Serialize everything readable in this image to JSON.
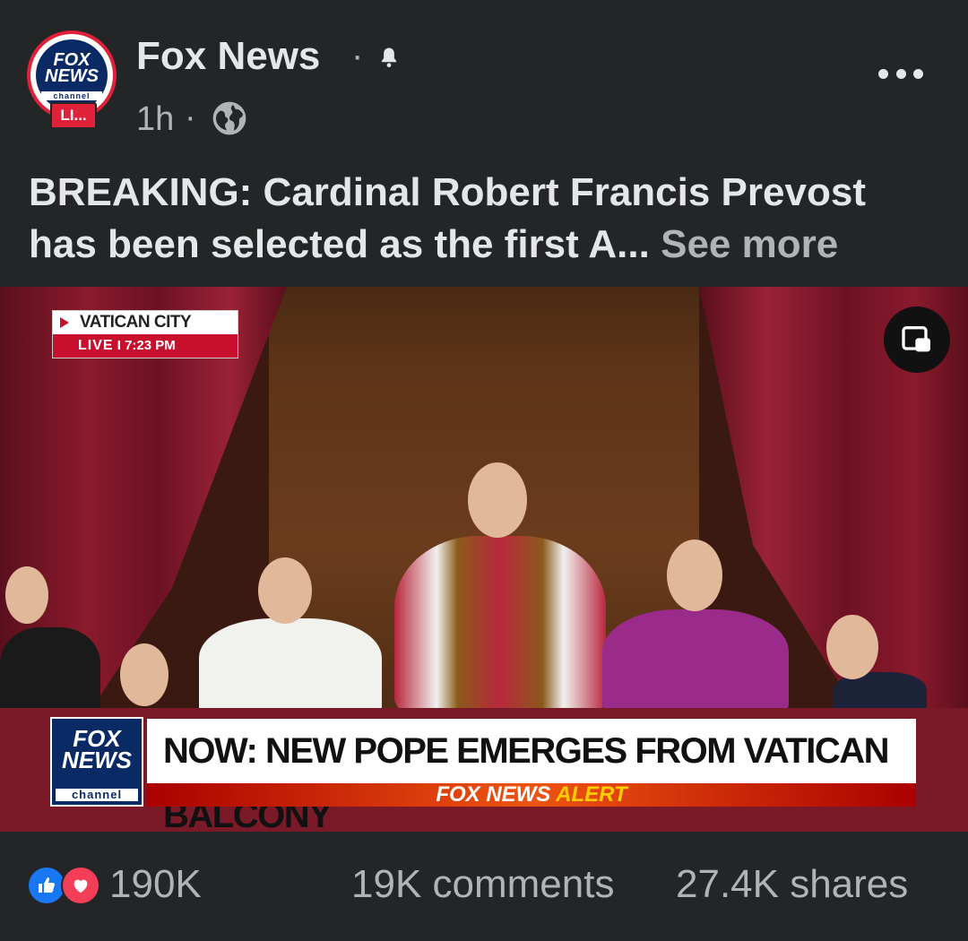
{
  "post": {
    "page_name": "Fox News",
    "avatar_logo": "FOX NEWS",
    "avatar_channel": "channel",
    "live_badge": "LI...",
    "time": "1h",
    "separator": "·",
    "text": "BREAKING: Cardinal Robert Francis Prevost has been selected as the first A...",
    "see_more": "See more"
  },
  "video": {
    "location": "VATICAN CITY",
    "live_label": "LIVE",
    "live_time": "7:23 PM",
    "logo_text": "FOX NEWS",
    "logo_channel": "channel",
    "headline": "NOW: NEW POPE EMERGES FROM VATICAN BALCONY",
    "alert_brand": "FOX NEWS",
    "alert_word": "ALERT"
  },
  "footer": {
    "reactions_count": "190K",
    "comments": "19K comments",
    "shares": "27.4K shares"
  },
  "icons": [
    "bell-icon",
    "globe-icon",
    "more-options-icon",
    "picture-in-picture-icon",
    "like-reaction-icon",
    "love-reaction-icon"
  ],
  "colors": {
    "background": "#242526",
    "fox_red": "#e0213a",
    "fox_blue": "#0a2a66",
    "like_blue": "#1877f2",
    "love_red": "#f33e58"
  }
}
